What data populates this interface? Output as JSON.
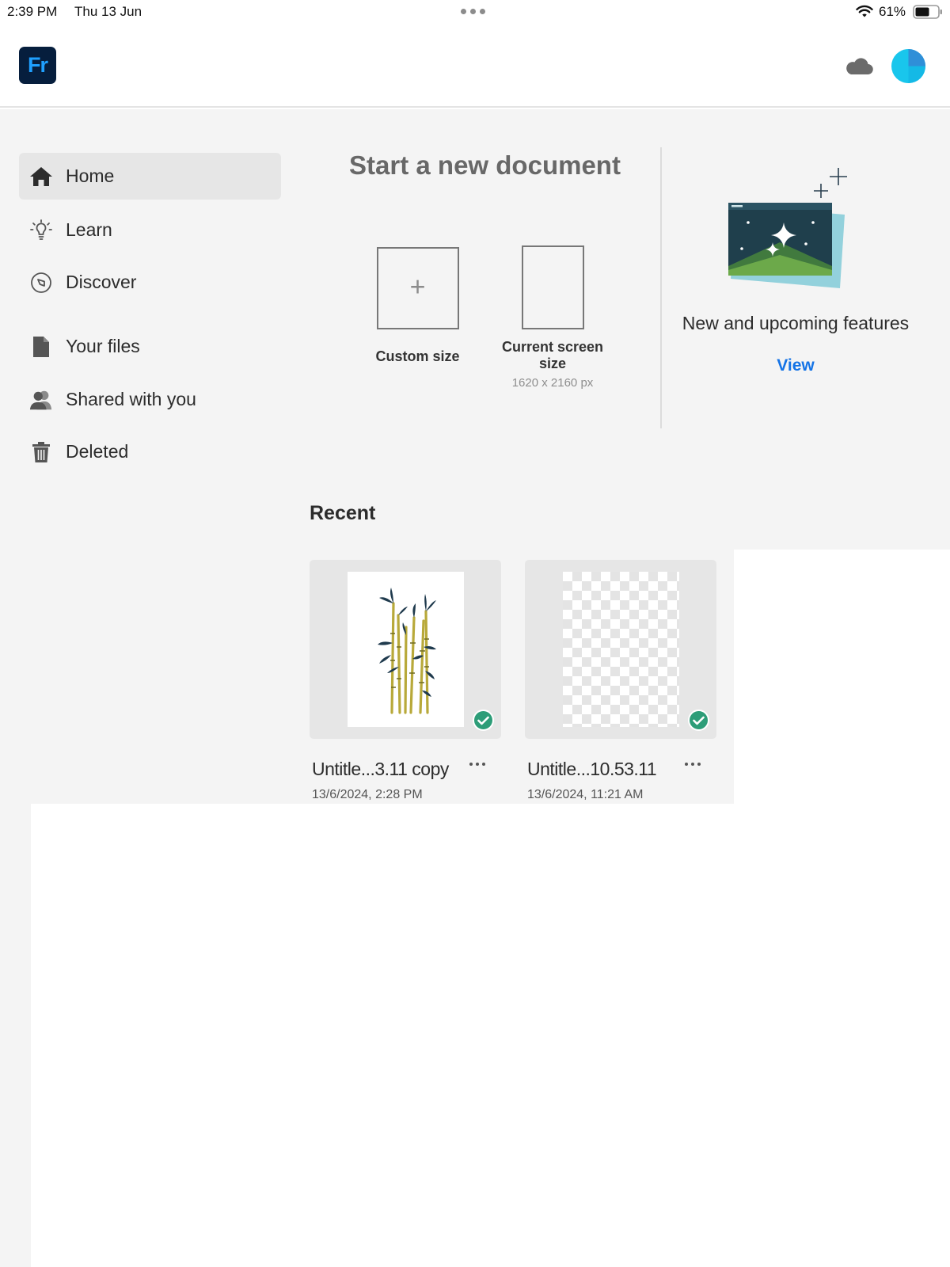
{
  "status_bar": {
    "time": "2:39 PM",
    "date": "Thu 13 Jun",
    "battery": "61%"
  },
  "header": {
    "logo_text": "Fr",
    "logo_color": "#061e3d",
    "accent_color": "#1fa0ff"
  },
  "sidebar": {
    "items": [
      {
        "label": "Home",
        "icon": "home-icon",
        "active": true
      },
      {
        "label": "Learn",
        "icon": "lightbulb-icon",
        "active": false
      },
      {
        "label": "Discover",
        "icon": "compass-icon",
        "active": false
      },
      {
        "label": "Your files",
        "icon": "file-icon",
        "active": false
      },
      {
        "label": "Shared with you",
        "icon": "shared-users-icon",
        "active": false
      },
      {
        "label": "Deleted",
        "icon": "trash-icon",
        "active": false
      }
    ]
  },
  "new_document": {
    "title": "Start a new document",
    "presets": [
      {
        "label": "Custom size",
        "sub": ""
      },
      {
        "label": "Current screen size",
        "sub": "1620 x 2160 px"
      }
    ]
  },
  "features": {
    "title": "New and upcoming features",
    "link": "View",
    "link_color": "#1473e6"
  },
  "recent": {
    "title": "Recent",
    "files": [
      {
        "name": "Untitle...3.11 copy",
        "date": "13/6/2024, 2:28 PM",
        "synced": true,
        "thumb": "bamboo-painting"
      },
      {
        "name": "Untitle...10.53.11",
        "date": "13/6/2024, 11:21 AM",
        "synced": true,
        "thumb": "transparent-canvas"
      }
    ]
  }
}
